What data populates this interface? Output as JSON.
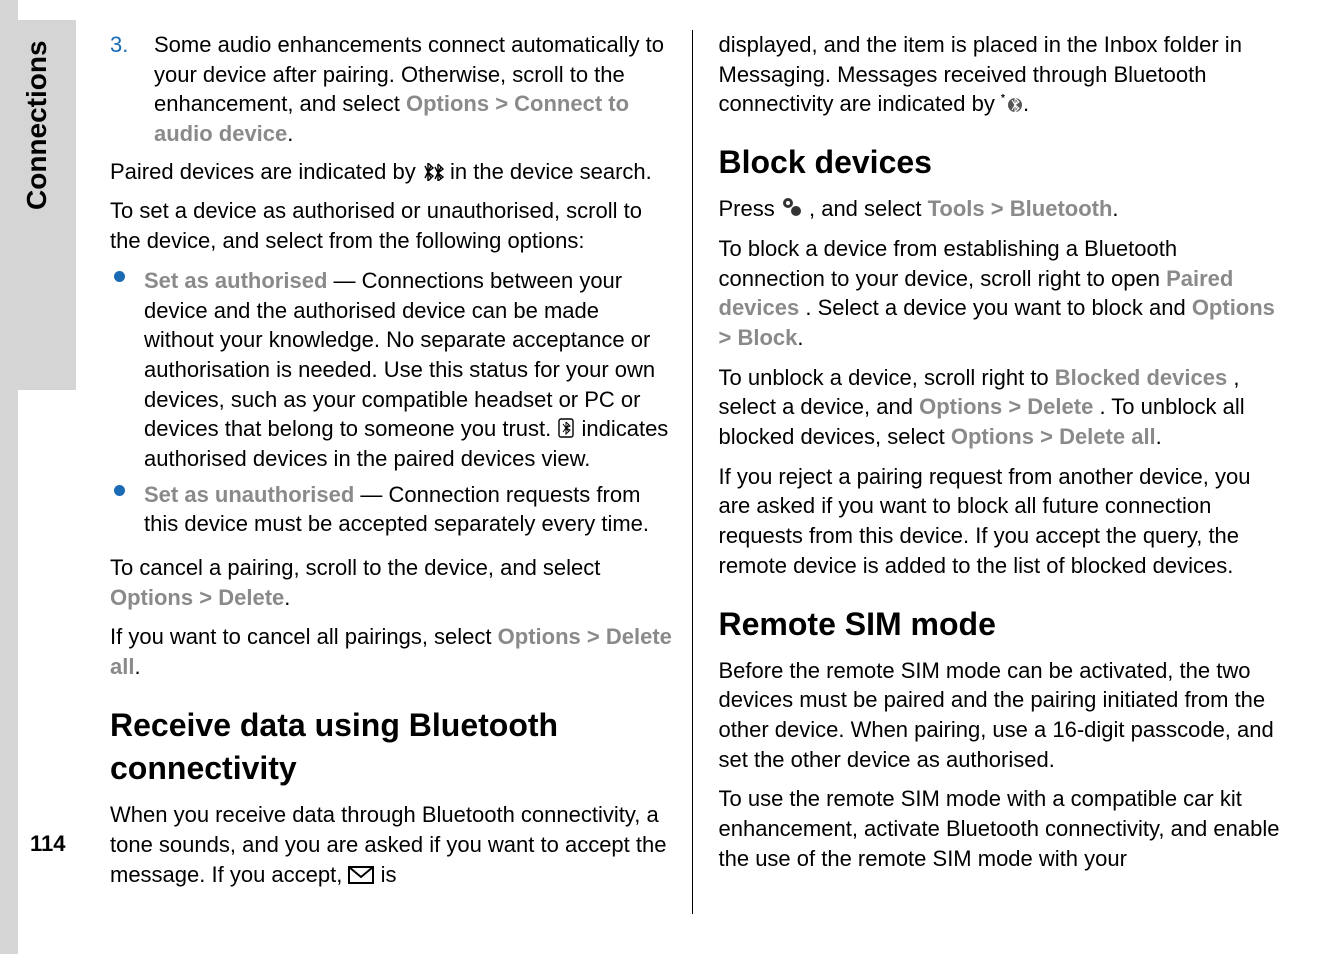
{
  "sidebar": {
    "label": "Connections"
  },
  "page_number": "114",
  "left": {
    "step3_num": "3.",
    "step3_text": "Some audio enhancements connect automatically to your device after pairing. Otherwise, scroll to the enhancement, and select ",
    "step3_opt": "Options",
    "step3_gt": ">",
    "step3_connect": "Connect to audio device",
    "step3_period": ".",
    "paired_pre": "Paired devices are indicated by ",
    "paired_post": " in the device search.",
    "auth_intro": "To set a device as authorised or unauthorised, scroll to the device, and select from the following options:",
    "set_auth_label": "Set as authorised",
    "set_auth_pre": "  —  Connections between your device and the authorised device can be made without your knowledge. No separate acceptance or authorisation is needed. Use this status for your own devices, such as your compatible headset or PC or devices that belong to someone you trust. ",
    "set_auth_post": " indicates authorised devices in the paired devices view.",
    "set_unauth_label": "Set as unauthorised",
    "set_unauth_text": "  —  Connection requests from this device must be accepted separately every time.",
    "cancel_pair_pre": "To cancel a pairing, scroll to the device, and select ",
    "cancel_pair_opt": "Options",
    "cancel_pair_gt": ">",
    "cancel_pair_del": "Delete",
    "cancel_pair_period": ".",
    "cancel_all_pre": "If you want to cancel all pairings, select ",
    "cancel_all_opt": "Options",
    "cancel_all_gt": ">",
    "cancel_all_del": "Delete all",
    "cancel_all_period": ".",
    "h_receive": "Receive data using Bluetooth connectivity",
    "receive_pre": "When you receive data through Bluetooth connectivity, a tone sounds, and you are asked if you want to accept the message. If you accept, ",
    "receive_post": " is"
  },
  "right": {
    "cont_pre": "displayed, and the item is placed in the Inbox folder in Messaging. Messages received through Bluetooth connectivity are indicated by ",
    "cont_post": ".",
    "h_block": "Block devices",
    "block_press_pre": "Press ",
    "block_press_mid": " , and select ",
    "block_press_tools": "Tools",
    "block_press_gt": ">",
    "block_press_bt": "Bluetooth",
    "block_press_period": ".",
    "block_p2a": "To block a device from establishing a Bluetooth connection to your device, scroll right to open ",
    "block_p2_paired": "Paired devices",
    "block_p2b": ". Select a device you want to block and ",
    "block_p2_opt": "Options",
    "block_p2_gt": ">",
    "block_p2_block": "Block",
    "block_p2_period": ".",
    "block_p3a": "To unblock a device, scroll right to ",
    "block_p3_blocked": "Blocked devices",
    "block_p3b": ", select a device, and ",
    "block_p3_opt": "Options",
    "block_p3_gt1": ">",
    "block_p3_del": "Delete",
    "block_p3c": ". To unblock all blocked devices, select ",
    "block_p3_opt2": "Options",
    "block_p3_gt2": ">",
    "block_p3_delall": "Delete all",
    "block_p3_period": ".",
    "block_p4": "If you reject a pairing request from another device, you are asked if you want to block all future connection requests from this device. If you accept the query, the remote device is added to the list of blocked devices.",
    "h_remote": "Remote SIM mode",
    "remote_p1": "Before the remote SIM mode can be activated, the two devices must be paired and the pairing initiated from the other device. When pairing, use a 16-digit passcode, and set the other device as authorised.",
    "remote_p2": "To use the remote SIM mode with a compatible car kit enhancement, activate Bluetooth connectivity, and enable the use of the remote SIM mode with your"
  }
}
